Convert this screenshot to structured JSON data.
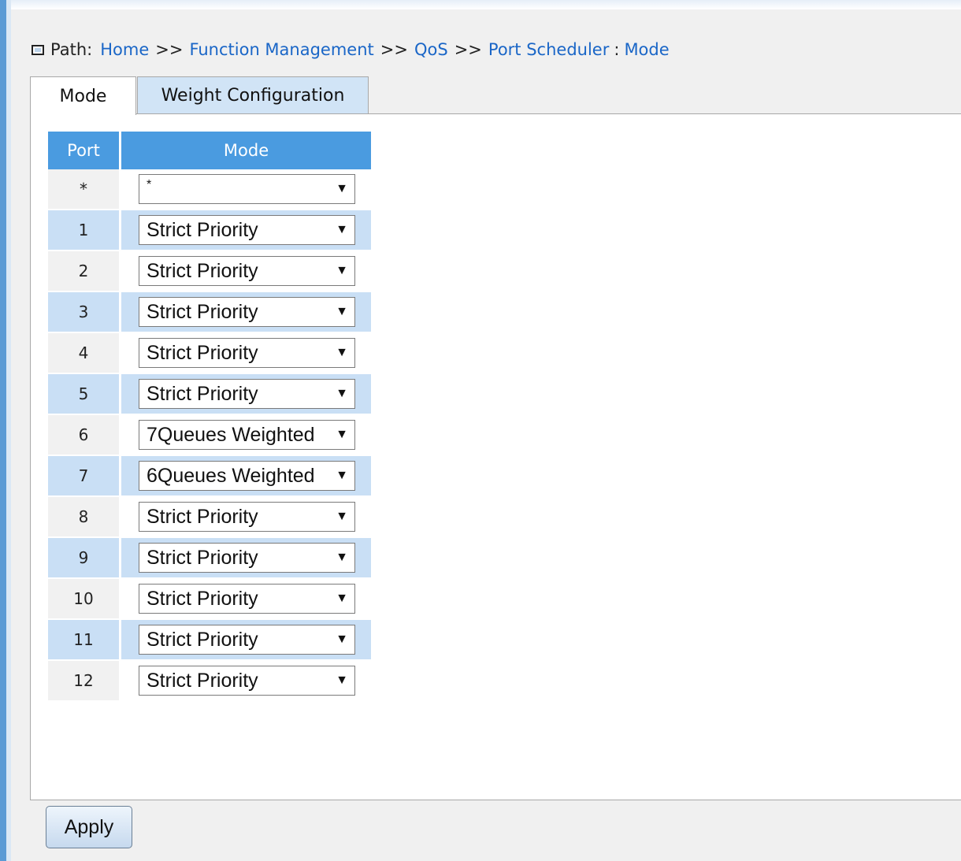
{
  "breadcrumb": {
    "label": "Path:",
    "items": [
      "Home",
      "Function Management",
      "QoS",
      "Port Scheduler",
      "Mode"
    ],
    "separator": ">>",
    "last_separator": ":"
  },
  "tabs": [
    {
      "label": "Mode",
      "active": true
    },
    {
      "label": "Weight Configuration",
      "active": false
    }
  ],
  "table": {
    "headers": {
      "port": "Port",
      "mode": "Mode"
    },
    "rows": [
      {
        "port": "*",
        "mode": "*"
      },
      {
        "port": "1",
        "mode": "Strict Priority"
      },
      {
        "port": "2",
        "mode": "Strict Priority"
      },
      {
        "port": "3",
        "mode": "Strict Priority"
      },
      {
        "port": "4",
        "mode": "Strict Priority"
      },
      {
        "port": "5",
        "mode": "Strict Priority"
      },
      {
        "port": "6",
        "mode": "7Queues Weighted"
      },
      {
        "port": "7",
        "mode": "6Queues Weighted"
      },
      {
        "port": "8",
        "mode": "Strict Priority"
      },
      {
        "port": "9",
        "mode": "Strict Priority"
      },
      {
        "port": "10",
        "mode": "Strict Priority"
      },
      {
        "port": "11",
        "mode": "Strict Priority"
      },
      {
        "port": "12",
        "mode": "Strict Priority"
      }
    ]
  },
  "apply_label": "Apply",
  "colors": {
    "header_blue": "#4a9be0",
    "row_alt": "#c9dff5",
    "link": "#1a66c7",
    "tab_inactive": "#d1e4f6"
  },
  "icons": {
    "dropdown": "chevron-down-icon",
    "path_marker": "square-icon"
  }
}
